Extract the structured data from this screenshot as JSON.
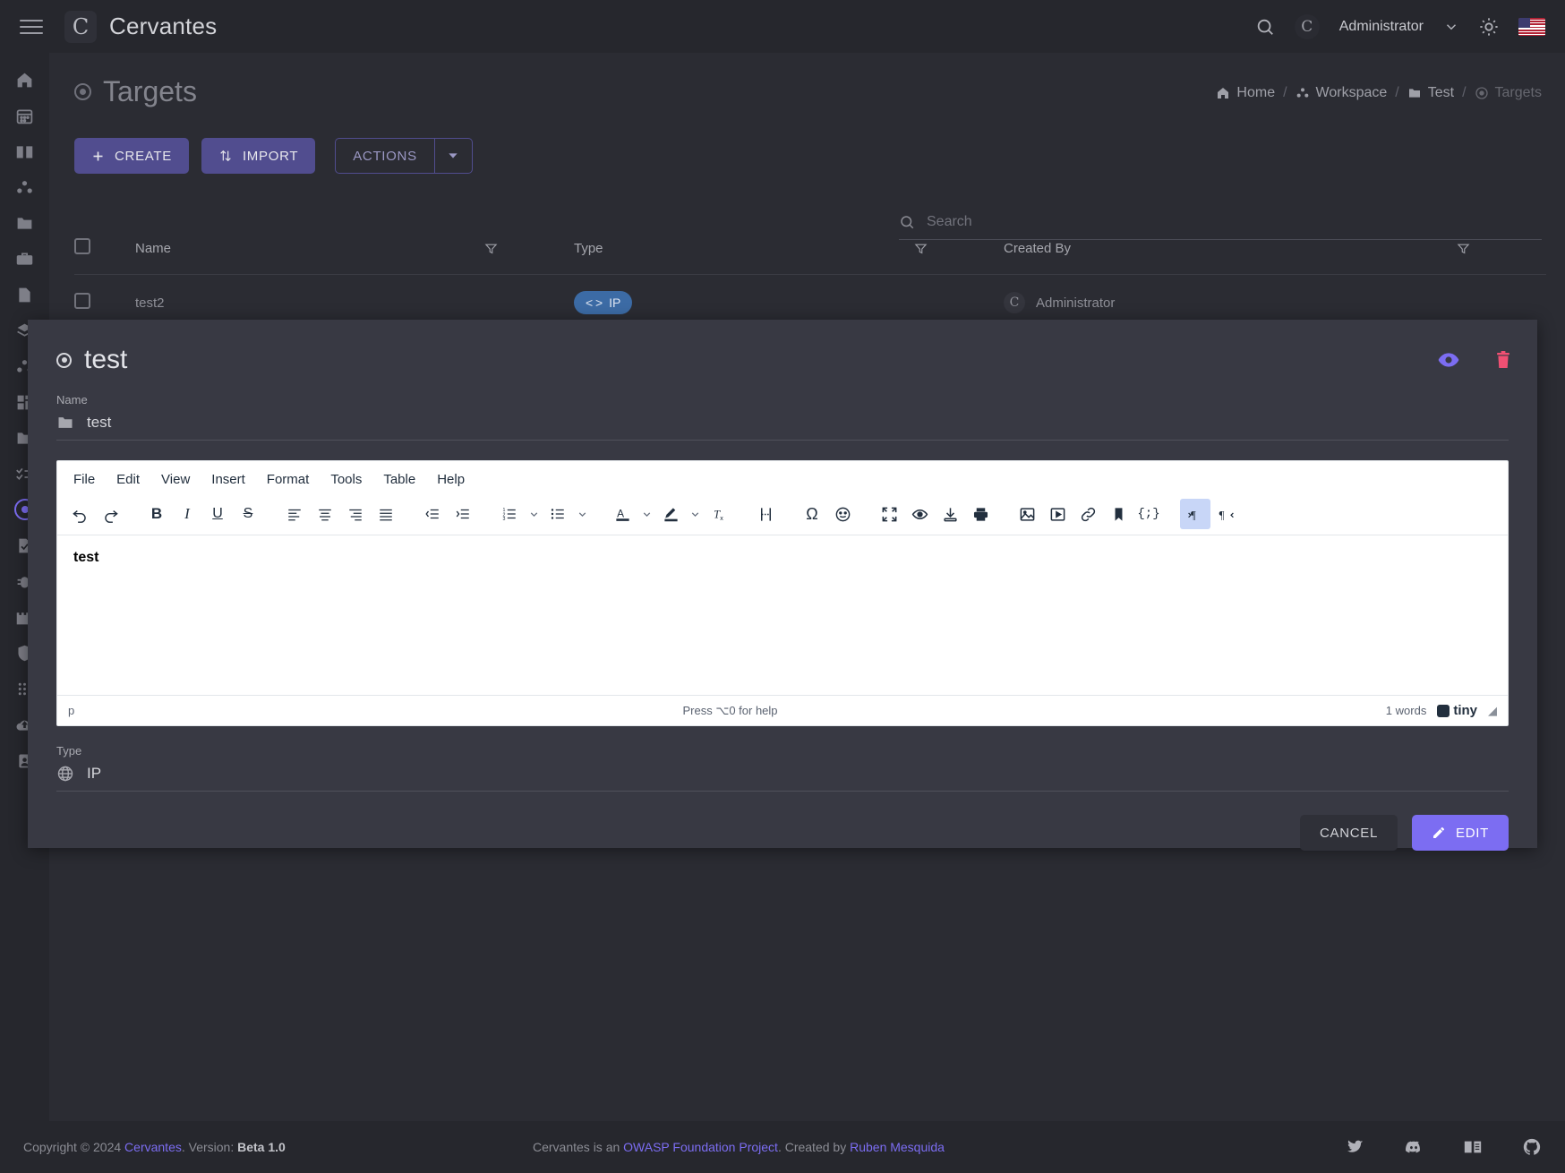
{
  "app": {
    "brand": "Cervantes",
    "menu_icon": "hamburger-icon",
    "search_icon": "search-icon",
    "user": "Administrator",
    "theme_icon": "sun-icon",
    "language": "en-US"
  },
  "sidebar": {
    "items": [
      {
        "name": "home",
        "icon": "home-icon"
      },
      {
        "name": "calendar",
        "icon": "calendar-icon"
      },
      {
        "name": "knowledge-base",
        "icon": "book-icon"
      },
      {
        "name": "clients",
        "icon": "group-icon"
      },
      {
        "name": "projects",
        "icon": "folder-icon"
      },
      {
        "name": "jobs",
        "icon": "briefcase-icon"
      },
      {
        "name": "reports",
        "icon": "document-icon"
      },
      {
        "name": "templates",
        "icon": "layers-icon"
      },
      {
        "name": "teams",
        "icon": "group-icon"
      },
      {
        "name": "dashboard",
        "icon": "grid-icon"
      },
      {
        "name": "archive",
        "icon": "folder-icon"
      },
      {
        "name": "tasks",
        "icon": "checklist-icon"
      },
      {
        "name": "targets",
        "icon": "target-icon",
        "active": true
      },
      {
        "name": "checklists",
        "icon": "file-check-icon"
      },
      {
        "name": "vulnerabilities",
        "icon": "bug-icon"
      },
      {
        "name": "assets",
        "icon": "castle-icon"
      },
      {
        "name": "defenses",
        "icon": "shield-icon"
      },
      {
        "name": "apps",
        "icon": "dots-grid-icon"
      },
      {
        "name": "uploads",
        "icon": "cloud-upload-icon"
      },
      {
        "name": "users",
        "icon": "id-card-icon"
      }
    ]
  },
  "page": {
    "title": "Targets",
    "title_icon": "target-icon"
  },
  "breadcrumb": [
    {
      "label": "Home",
      "icon": "home-icon"
    },
    {
      "label": "Workspace",
      "icon": "group-icon"
    },
    {
      "label": "Test",
      "icon": "folder-icon"
    },
    {
      "label": "Targets",
      "icon": "target-icon"
    }
  ],
  "toolbar": {
    "create_label": "CREATE",
    "create_icon": "plus-icon",
    "import_label": "IMPORT",
    "import_icon": "import-arrows-icon",
    "actions_label": "ACTIONS",
    "actions_caret_icon": "chevron-down-icon"
  },
  "search": {
    "placeholder": "Search",
    "value": "",
    "icon": "search-icon"
  },
  "table": {
    "columns": [
      "Name",
      "Type",
      "Created By"
    ],
    "filter_icon": "filter-icon",
    "rows": [
      {
        "name": "test2",
        "type": "IP",
        "type_icon": "code-brackets-icon",
        "created_by": "Administrator"
      }
    ]
  },
  "modal": {
    "title": "test",
    "title_icon": "target-icon",
    "preview_icon": "eye-icon",
    "delete_icon": "trash-icon",
    "name_label": "Name",
    "name_value": "test",
    "name_icon": "folder-icon",
    "type_label": "Type",
    "type_value": "IP",
    "type_icon": "globe-icon",
    "cancel_label": "CANCEL",
    "edit_label": "EDIT",
    "edit_icon": "pencil-icon",
    "accent": "#7c6df2",
    "danger": "#f05073"
  },
  "editor": {
    "menubar": [
      "File",
      "Edit",
      "View",
      "Insert",
      "Format",
      "Tools",
      "Table",
      "Help"
    ],
    "toolbar_groups": [
      [
        "undo-icon",
        "redo-icon"
      ],
      [
        "bold-icon",
        "italic-icon",
        "underline-icon",
        "strikethrough-icon"
      ],
      [
        "align-left-icon",
        "align-center-icon",
        "align-right-icon",
        "align-justify-icon"
      ],
      [
        "outdent-icon",
        "indent-icon"
      ],
      [
        "numbered-list-icon",
        "chevron-down-icon",
        "bullet-list-icon",
        "chevron-down-icon"
      ],
      [
        "text-color-icon",
        "chevron-down-icon",
        "highlight-color-icon",
        "chevron-down-icon",
        "clear-formatting-icon"
      ],
      [
        "page-break-icon"
      ],
      [
        "special-character-icon",
        "emoji-icon"
      ],
      [
        "fullscreen-icon",
        "preview-icon",
        "save-icon",
        "print-icon"
      ],
      [
        "image-icon",
        "media-icon",
        "link-icon",
        "anchor-icon",
        "code-sample-icon"
      ],
      [
        "ltr-icon",
        "rtl-icon"
      ]
    ],
    "active_tool": "ltr-icon",
    "content": "test",
    "status_path": "p",
    "status_help": "Press ⌥0 for help",
    "word_count": "1 words",
    "branding": "tiny"
  },
  "footer": {
    "copyright_prefix": "Copyright © 2024 ",
    "copyright_link": "Cervantes",
    "version_label": ". Version: ",
    "version_value": "Beta 1.0",
    "mid_prefix": "Cervantes is an ",
    "mid_link1": "OWASP Foundation Project",
    "mid_middle": ". Created by ",
    "mid_link2": "Ruben Mesquida",
    "social": [
      "twitter-icon",
      "discord-icon",
      "book-icon",
      "github-icon"
    ]
  }
}
